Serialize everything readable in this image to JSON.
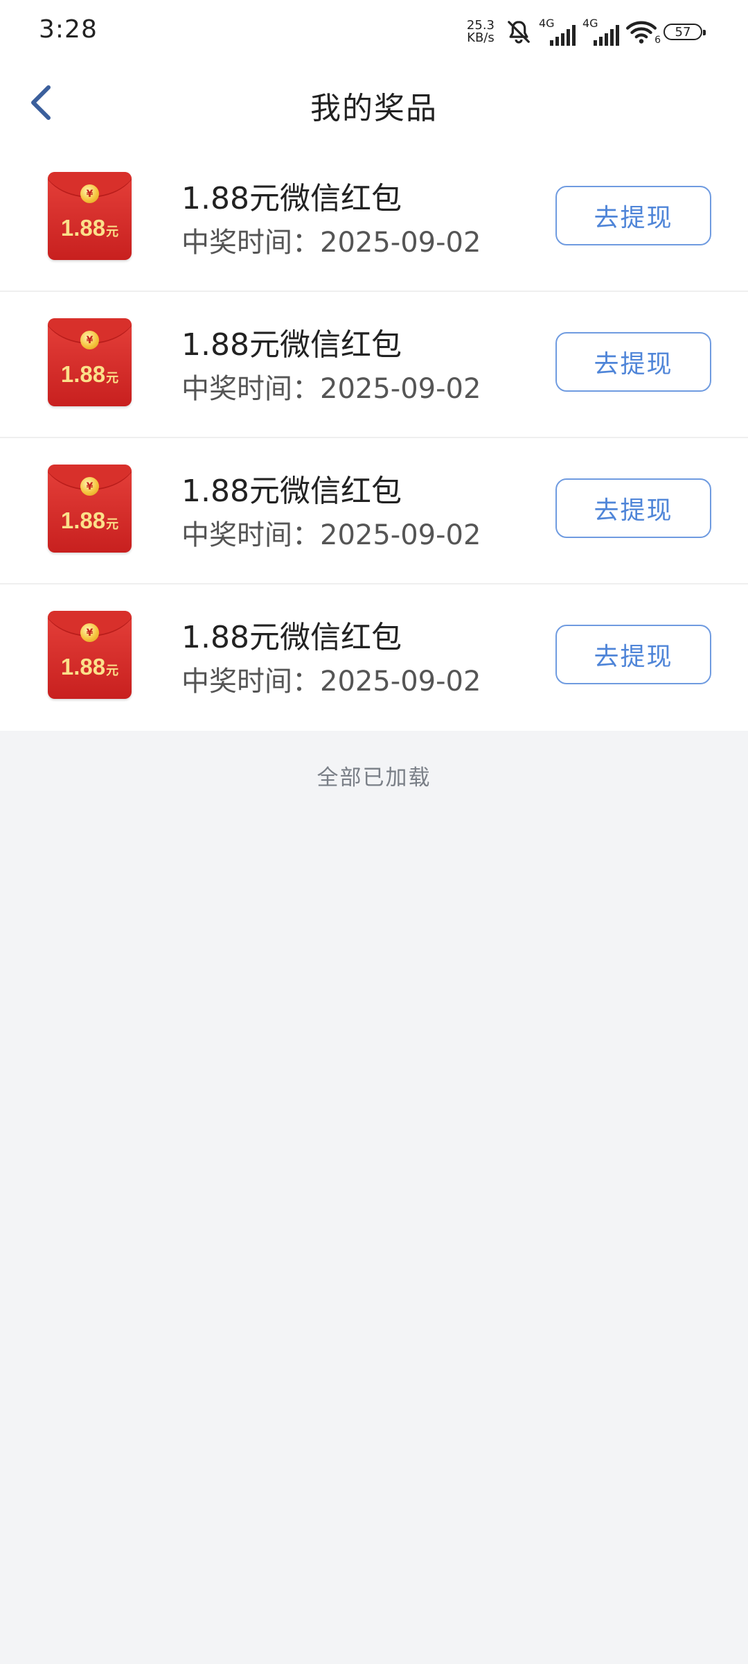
{
  "status_bar": {
    "time": "3:28",
    "net_speed_value": "25.3",
    "net_speed_unit": "KB/s",
    "sim1_type": "4G",
    "sim2_type": "4G",
    "wifi_badge": "6",
    "battery": "57",
    "icons": [
      "mute-bell-icon",
      "signal-icon",
      "signal-icon",
      "wifi-icon",
      "battery-icon"
    ]
  },
  "header": {
    "title": "我的奖品",
    "back_icon": "chevron-left-icon"
  },
  "prizes": [
    {
      "packet_amount": "1.88",
      "packet_unit": "元",
      "name": "1.88元微信红包",
      "time": "中奖时间：2025-09-02",
      "button": "去提现"
    },
    {
      "packet_amount": "1.88",
      "packet_unit": "元",
      "name": "1.88元微信红包",
      "time": "中奖时间：2025-09-02",
      "button": "去提现"
    },
    {
      "packet_amount": "1.88",
      "packet_unit": "元",
      "name": "1.88元微信红包",
      "time": "中奖时间：2025-09-02",
      "button": "去提现"
    },
    {
      "packet_amount": "1.88",
      "packet_unit": "元",
      "name": "1.88元微信红包",
      "time": "中奖时间：2025-09-02",
      "button": "去提现"
    }
  ],
  "footer": {
    "loaded_text": "全部已加载"
  },
  "colors": {
    "accent": "#4f85d8",
    "button_border": "#6f9be0",
    "page_background": "#f3f4f6",
    "packet_red": "#d8302b",
    "packet_gold": "#fbe08a"
  }
}
